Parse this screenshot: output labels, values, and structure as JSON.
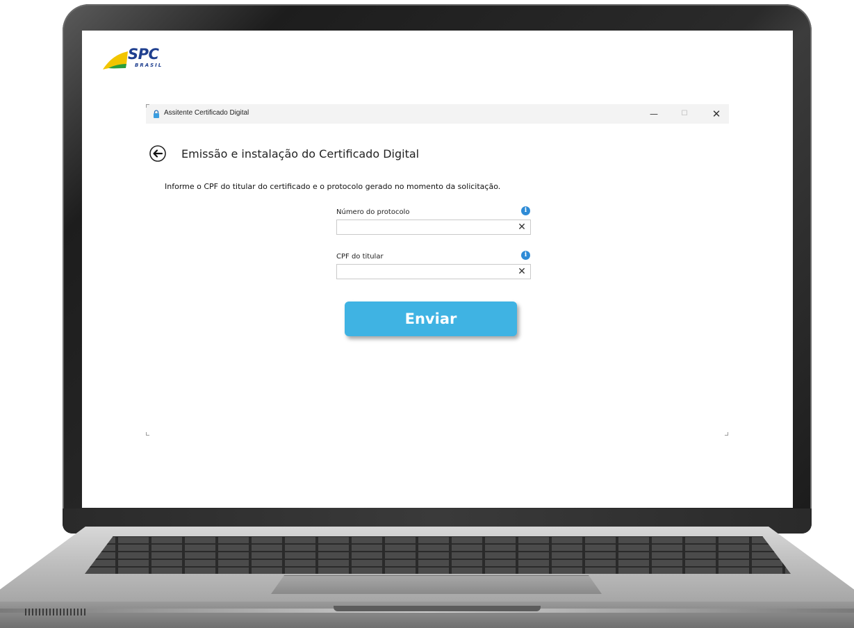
{
  "brand": {
    "logo_text": "SPC",
    "logo_sub": "BRASIL"
  },
  "window": {
    "title": "Assitente Certificado Digital",
    "minimize_glyph": "—",
    "maximize_glyph": "☐",
    "close_glyph": "✕"
  },
  "page": {
    "title": "Emissão e instalação do Certificado Digital",
    "instructions": "Informe o CPF do titular do certificado e o protocolo gerado no momento da solicitação."
  },
  "form": {
    "protocol": {
      "label": "Número do protocolo",
      "value": "",
      "clear_glyph": "✕",
      "info_glyph": "i"
    },
    "cpf": {
      "label": "CPF do titular",
      "value": "",
      "clear_glyph": "✕",
      "info_glyph": "i"
    },
    "submit_label": "Enviar"
  },
  "colors": {
    "accent": "#3fb3e3",
    "info": "#2e8bd6",
    "brand_blue": "#1f3f8f",
    "brand_yellow": "#f2c500"
  }
}
